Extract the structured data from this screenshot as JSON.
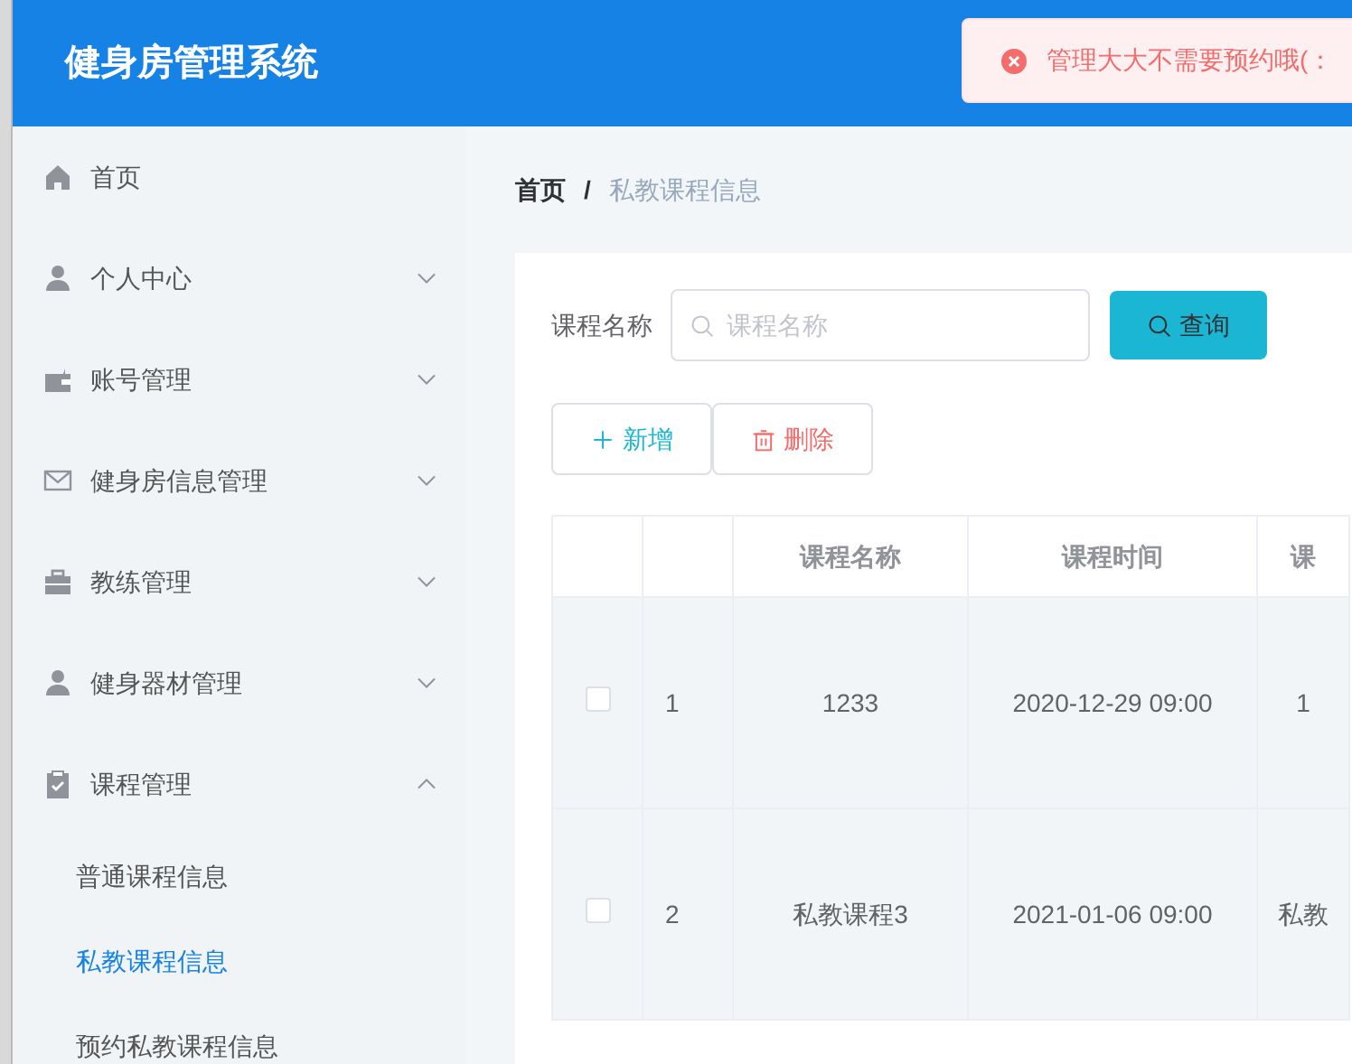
{
  "app_title": "健身房管理系统",
  "toast": {
    "kind": "error",
    "message": "管理大大不需要预约哦(："
  },
  "sidebar": {
    "items": [
      {
        "label": "首页"
      },
      {
        "label": "个人中心",
        "expanded": false
      },
      {
        "label": "账号管理",
        "expanded": false
      },
      {
        "label": "健身房信息管理",
        "expanded": false
      },
      {
        "label": "教练管理",
        "expanded": false
      },
      {
        "label": "健身器材管理",
        "expanded": false
      },
      {
        "label": "课程管理",
        "expanded": true,
        "children": [
          {
            "label": "普通课程信息",
            "selected": false
          },
          {
            "label": "私教课程信息",
            "selected": true
          },
          {
            "label": "预约私教课程信息",
            "selected": false
          }
        ]
      }
    ]
  },
  "breadcrumb": {
    "separator": "/",
    "items": [
      "首页",
      "私教课程信息"
    ]
  },
  "search": {
    "label": "课程名称",
    "placeholder": "课程名称",
    "button": "查询"
  },
  "actions": [
    {
      "kind": "add",
      "label": "新增"
    },
    {
      "kind": "delete",
      "label": "删除"
    }
  ],
  "table": {
    "columns": [
      "",
      "课程名称",
      "课程时间",
      "课"
    ],
    "rows": [
      {
        "checked": false,
        "cells": [
          "1",
          "1233",
          "2020-12-29 09:00",
          "1"
        ]
      },
      {
        "checked": false,
        "cells": [
          "2",
          "私教课程3",
          "2021-01-06 09:00",
          "私教"
        ]
      }
    ]
  }
}
